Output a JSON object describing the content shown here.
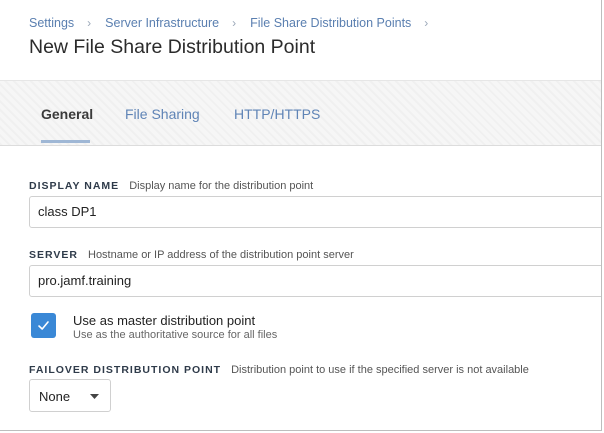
{
  "breadcrumb": [
    "Settings",
    "Server Infrastructure",
    "File Share Distribution Points"
  ],
  "page_title": "New File Share Distribution Point",
  "tabs": [
    {
      "label": "General",
      "active": true
    },
    {
      "label": "File Sharing",
      "active": false
    },
    {
      "label": "HTTP/HTTPS",
      "active": false
    }
  ],
  "form": {
    "display_name": {
      "label": "DISPLAY NAME",
      "help": "Display name for the distribution point",
      "value": "class DP1"
    },
    "server": {
      "label": "SERVER",
      "help": "Hostname or IP address of the distribution point server",
      "value": "pro.jamf.training"
    },
    "master": {
      "label": "Use as master distribution point",
      "help": "Use as the authoritative source for all files",
      "checked": true
    },
    "failover": {
      "label": "FAILOVER DISTRIBUTION POINT",
      "help": "Distribution point to use if the specified server is not available",
      "selected": "None"
    }
  },
  "colors": {
    "link": "#5a7fb0",
    "checkbox": "#3a88d6",
    "tab_underline": "#9fb7d5"
  },
  "icons": {
    "breadcrumb_separator": "chevron-right-icon",
    "select_caret": "caret-down-icon",
    "checkbox_check": "check-icon"
  }
}
